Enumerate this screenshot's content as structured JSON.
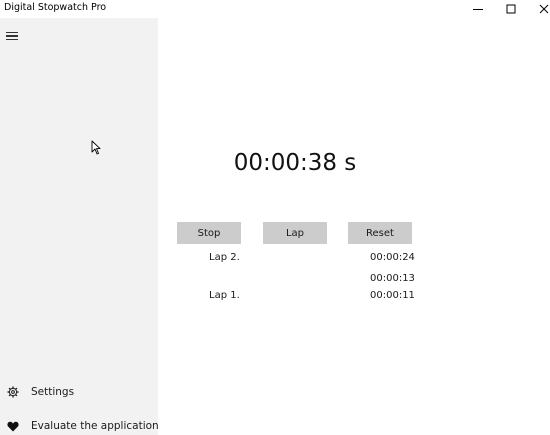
{
  "window": {
    "title": "Digital Stopwatch Pro",
    "controls": [
      "minimize-icon",
      "maximize-icon",
      "close-icon"
    ]
  },
  "sidebar": {
    "menu_icon": "hamburger-icon",
    "items": [
      {
        "label": "Settings",
        "icon": "gear-icon"
      },
      {
        "label": "Evaluate the application",
        "icon": "heart-icon"
      }
    ]
  },
  "stopwatch": {
    "display": "00:00:38 s",
    "buttons": {
      "stop": "Stop",
      "lap": "Lap",
      "reset": "Reset"
    },
    "laps": [
      {
        "label": "Lap 2.",
        "total": "00:00:24",
        "split": "00:00:13"
      },
      {
        "label": "Lap 1.",
        "total": "00:00:11"
      }
    ]
  }
}
